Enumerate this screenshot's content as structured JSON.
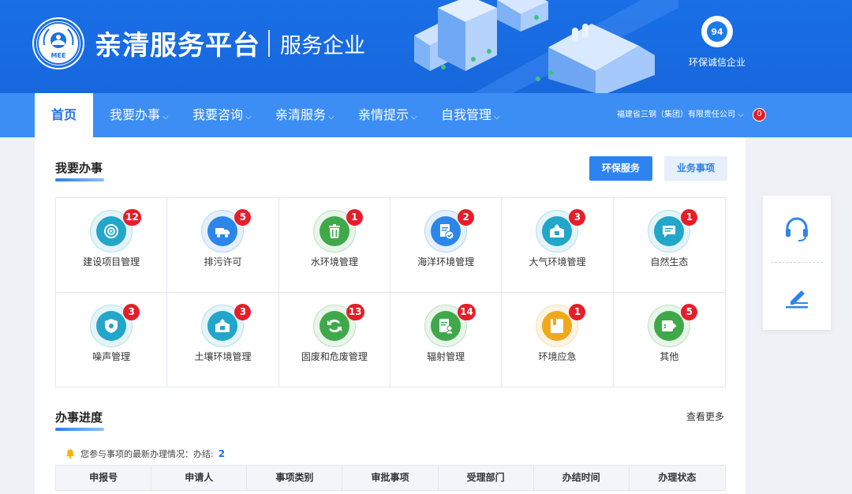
{
  "header": {
    "logo_text": "MEE",
    "title": "亲清服务平台",
    "subtitle": "服务企业",
    "credit_score": "94",
    "credit_label": "环保诚信企业"
  },
  "nav": {
    "items": [
      {
        "label": "首页",
        "active": true
      },
      {
        "label": "我要办事"
      },
      {
        "label": "我要咨询"
      },
      {
        "label": "亲清服务"
      },
      {
        "label": "亲情提示"
      },
      {
        "label": "自我管理"
      }
    ],
    "company": "福建省三钢（集团）有限责任公司",
    "message_count": "0"
  },
  "tasks": {
    "title": "我要办事",
    "tabs": [
      "环保服务",
      "业务事项"
    ],
    "items": [
      {
        "label": "建设项目管理",
        "count": "12",
        "icon": "target-icon",
        "color": "#22a6c9"
      },
      {
        "label": "排污许可",
        "count": "5",
        "icon": "truck-icon",
        "color": "#2c86e8"
      },
      {
        "label": "水环境管理",
        "count": "1",
        "icon": "trash-icon",
        "color": "#3fa94a"
      },
      {
        "label": "海洋环境管理",
        "count": "2",
        "icon": "document-check-icon",
        "color": "#2c86e8"
      },
      {
        "label": "大气环境管理",
        "count": "3",
        "icon": "box-icon",
        "color": "#22a6c9"
      },
      {
        "label": "自然生态",
        "count": "1",
        "icon": "chat-icon",
        "color": "#22a6c9"
      },
      {
        "label": "噪声管理",
        "count": "3",
        "icon": "shield-icon",
        "color": "#22a6c9"
      },
      {
        "label": "土壤环境管理",
        "count": "3",
        "icon": "box-icon",
        "color": "#22a6c9"
      },
      {
        "label": "固废和危废管理",
        "count": "13",
        "icon": "recycle-icon",
        "color": "#3fa94a"
      },
      {
        "label": "辐射管理",
        "count": "14",
        "icon": "report-user-icon",
        "color": "#3fa94a"
      },
      {
        "label": "环境应急",
        "count": "1",
        "icon": "folder-icon",
        "color": "#f2a81c"
      },
      {
        "label": "其他",
        "count": "5",
        "icon": "export-icon",
        "color": "#3fa94a"
      }
    ]
  },
  "progress": {
    "title": "办事进度",
    "more_label": "查看更多",
    "notice_text": "您参与事项的最新办理情况：办结:",
    "notice_count": "2",
    "columns": [
      "申报号",
      "申请人",
      "事项类别",
      "审批事项",
      "受理部门",
      "办结时间",
      "办理状态"
    ]
  },
  "side": {
    "icons": [
      "headset-icon",
      "edit-icon"
    ]
  }
}
